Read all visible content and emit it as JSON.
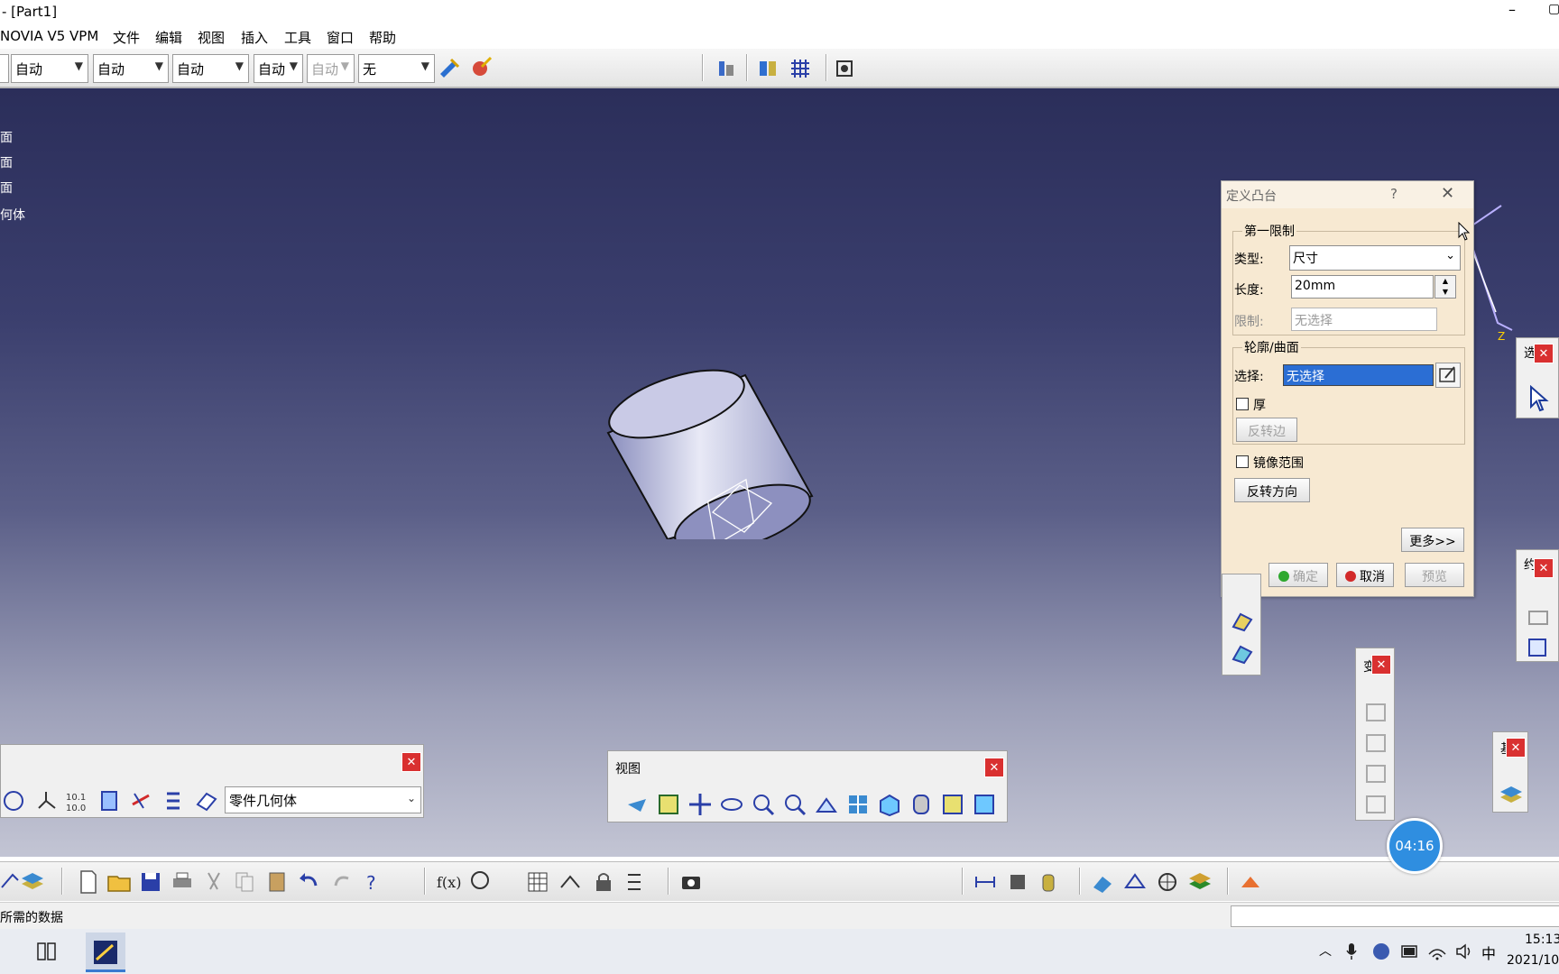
{
  "window": {
    "title": "- [Part1]",
    "minimize": "–",
    "restore": "▢"
  },
  "menu": {
    "items": [
      "NOVIA V5 VPM",
      "文件",
      "编辑",
      "视图",
      "插入",
      "工具",
      "窗口",
      "帮助"
    ]
  },
  "toolbar": {
    "combos": [
      "自动",
      "自动",
      "自动",
      "自动",
      "自动",
      "无"
    ],
    "combo_short": [
      "自动",
      "自动"
    ]
  },
  "tree": {
    "items": [
      "面",
      "面",
      "面",
      "何体"
    ]
  },
  "dialog": {
    "title": "定义凸台",
    "help": "?",
    "close": "✕",
    "group1": "第一限制",
    "type_label": "类型:",
    "type_value": "尺寸",
    "length_label": "长度:",
    "length_value": "20mm",
    "limit_label": "限制:",
    "limit_value": "无选择",
    "group2": "轮廓/曲面",
    "select_label": "选择:",
    "select_value": "无选择",
    "thick_label": "厚",
    "reverse_side": "反转边",
    "mirror_label": "镜像范围",
    "reverse_dir": "反转方向",
    "more": "更多>>",
    "ok": "确定",
    "cancel": "取消",
    "preview": "预览"
  },
  "float": {
    "part_combo": "零件几何体",
    "view_title": "视图",
    "close": "✕",
    "label_a": "选",
    "label_b": "约",
    "label_c": "变",
    "label_d": "基"
  },
  "status": {
    "message": "所需的数据"
  },
  "timer": {
    "text": "04:16"
  },
  "taskbar": {
    "time": "15:13",
    "date": "2021/10",
    "ime": "中"
  },
  "colors": {
    "viewport_top": "#2b2e5a",
    "selection": "#2b6ed4",
    "dialog_bg": "#f7e9d2",
    "close_red": "#d93030"
  }
}
